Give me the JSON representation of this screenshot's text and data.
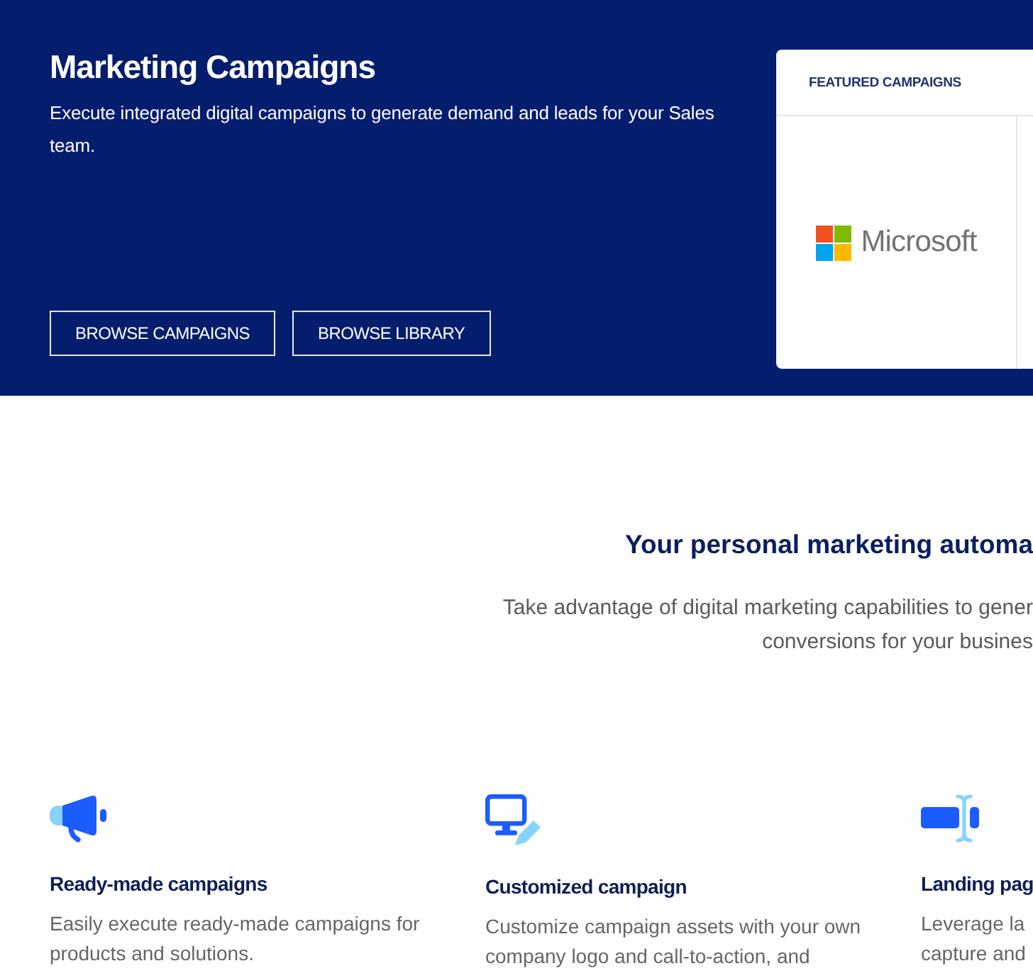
{
  "hero": {
    "title": "Marketing Campaigns",
    "description": "Execute integrated digital campaigns to generate demand and leads for your Sales team.",
    "buttons": [
      "BROWSE CAMPAIGNS",
      "BROWSE LIBRARY"
    ]
  },
  "featured": {
    "heading": "FEATURED CAMPAIGNS",
    "tiles": [
      {
        "logo_text": "Microsoft"
      }
    ]
  },
  "intro": {
    "heading": "Your personal marketing automa",
    "subtitle_lines": [
      "Take advantage of digital marketing capabilities to gener",
      "conversions for your busines"
    ]
  },
  "features": [
    {
      "kind": "megaphone",
      "title": "Ready-made campaigns",
      "lines": [
        "Easily execute ready-made campaigns for",
        "products and solutions."
      ]
    },
    {
      "kind": "monitor",
      "title": "Customized campaign",
      "lines": [
        "Customize campaign assets with your own",
        "company logo and call-to-action, and"
      ]
    },
    {
      "kind": "input",
      "title": "Landing pag",
      "lines": [
        "Leverage la",
        "capture and"
      ]
    }
  ]
}
